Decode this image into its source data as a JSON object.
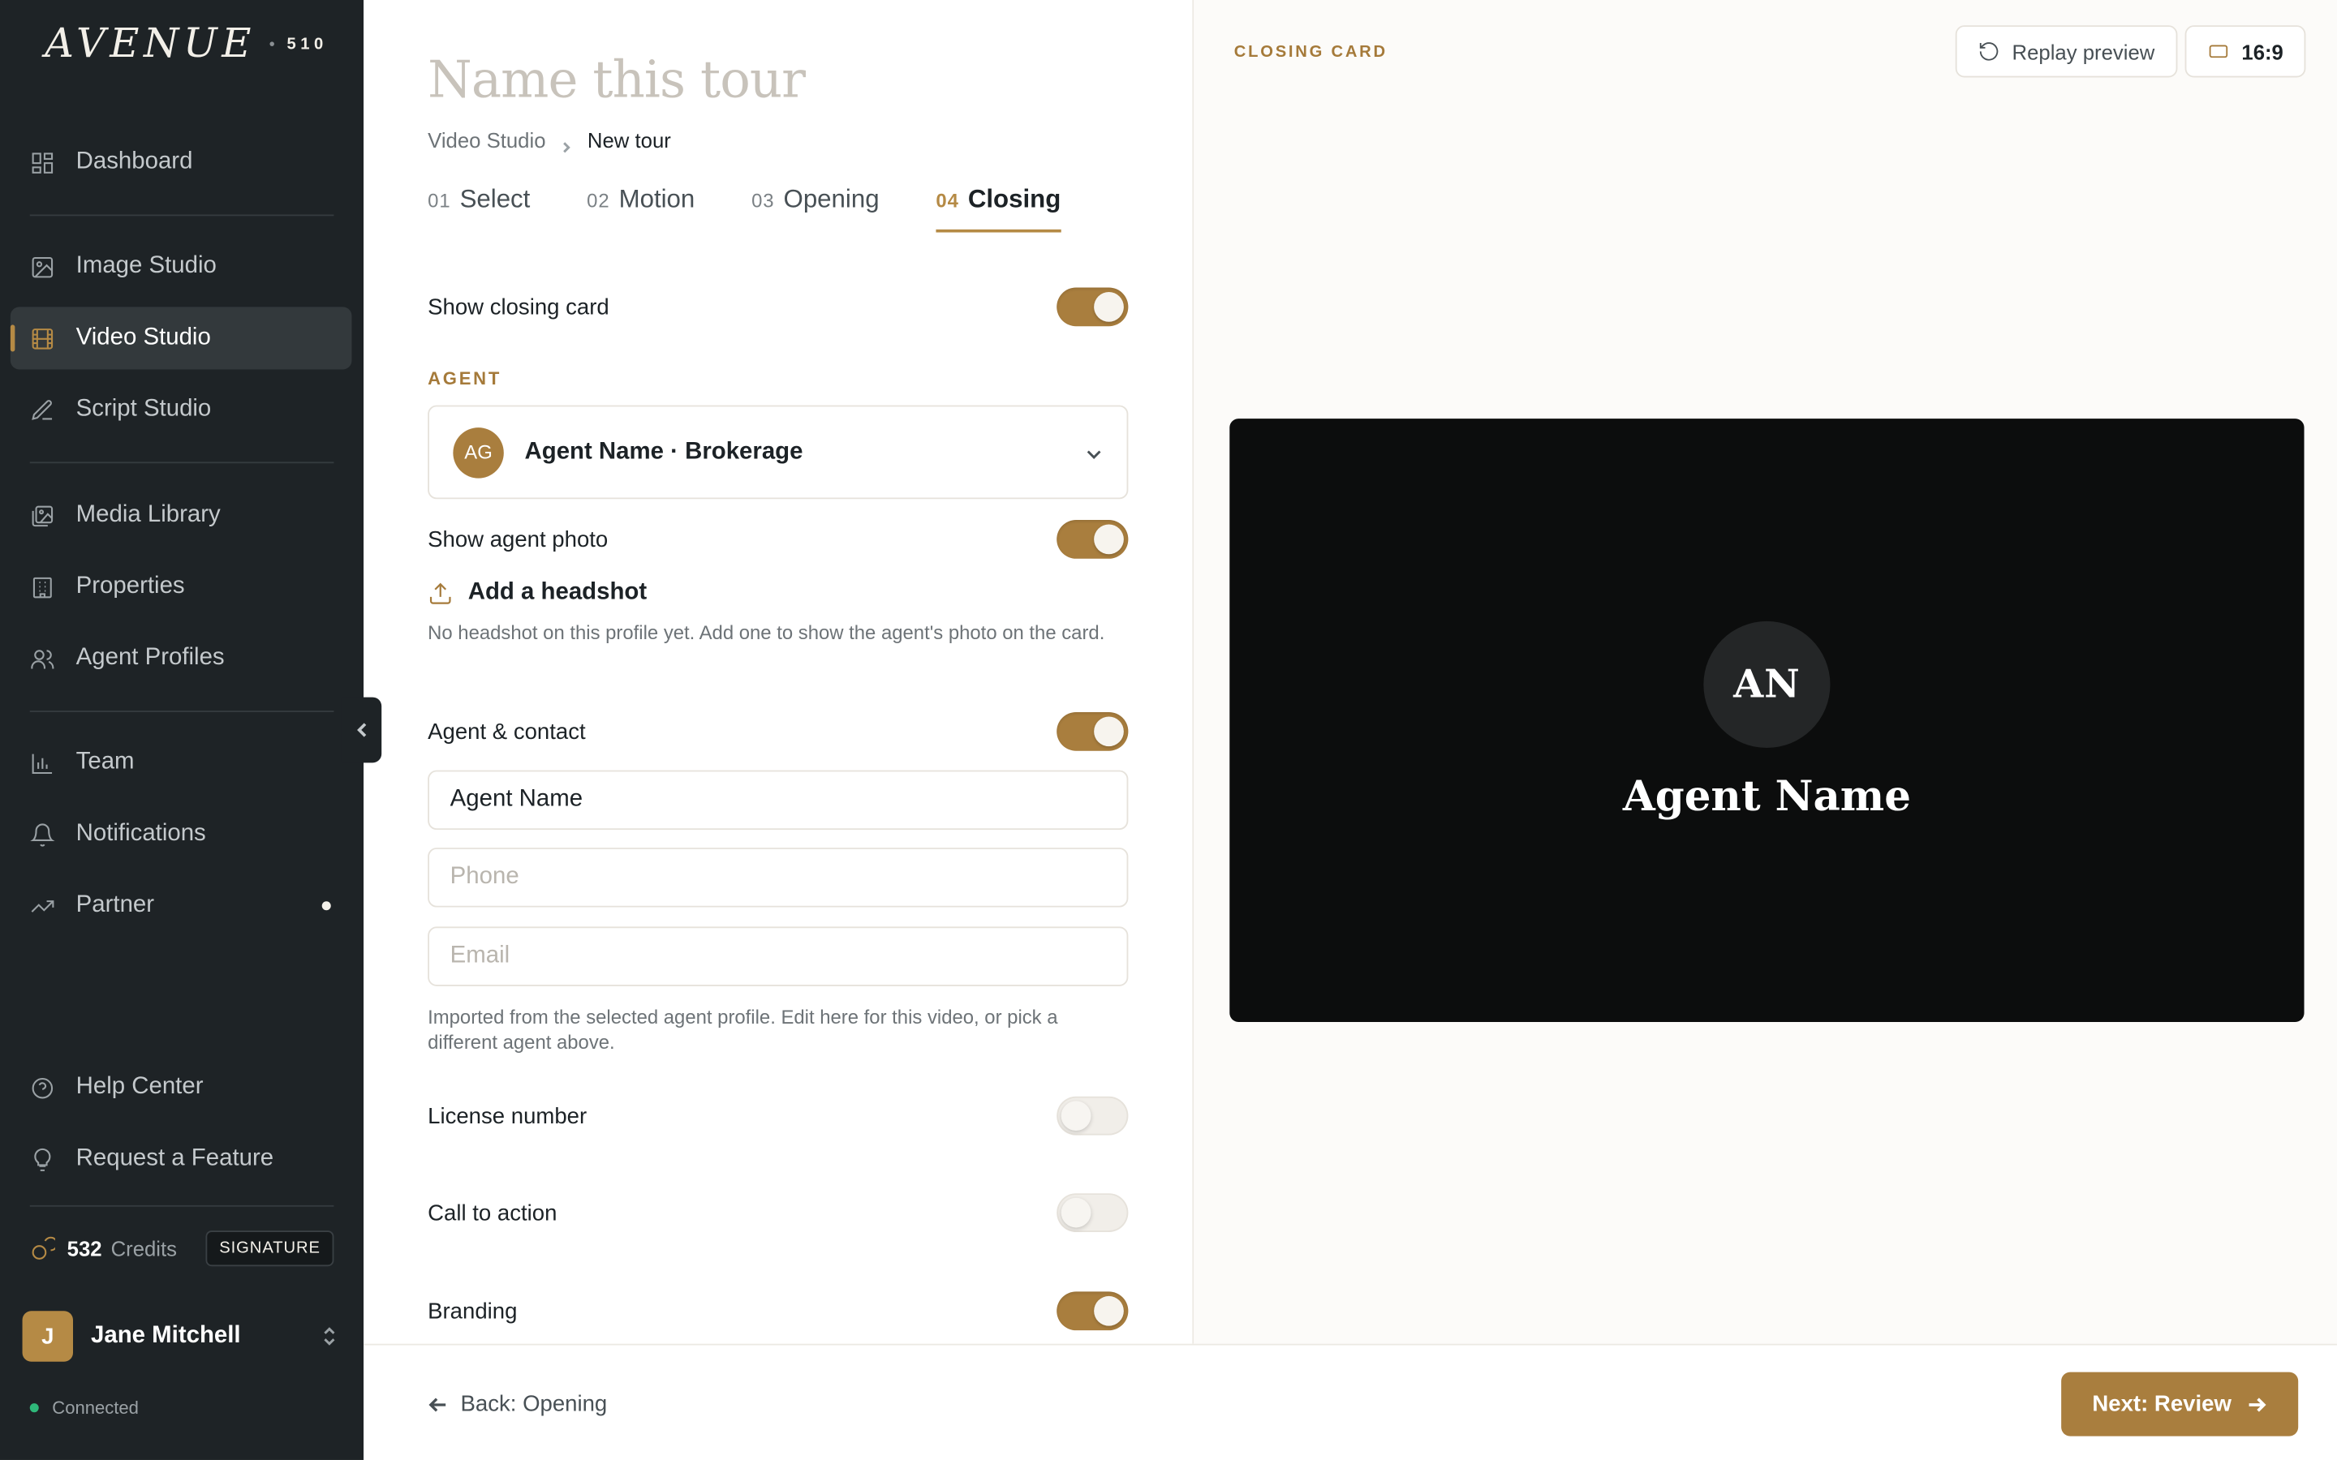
{
  "brand": {
    "word": "AVENUE",
    "suffix": "510"
  },
  "sidebar": {
    "items": [
      {
        "label": "Dashboard",
        "icon": "grid-icon"
      },
      {
        "label": "Image Studio",
        "icon": "image-icon"
      },
      {
        "label": "Video Studio",
        "icon": "film-icon",
        "active": true
      },
      {
        "label": "Script Studio",
        "icon": "pen-icon"
      },
      {
        "label": "Media Library",
        "icon": "images-icon"
      },
      {
        "label": "Properties",
        "icon": "building-icon"
      },
      {
        "label": "Agent Profiles",
        "icon": "users-icon"
      },
      {
        "label": "Team",
        "icon": "bar-chart-icon"
      },
      {
        "label": "Notifications",
        "icon": "bell-icon"
      },
      {
        "label": "Partner",
        "icon": "trending-up-icon"
      },
      {
        "label": "Help Center",
        "icon": "help-circle-icon"
      },
      {
        "label": "Request a Feature",
        "icon": "lightbulb-icon"
      }
    ],
    "credits": {
      "count": "532",
      "label": "Credits",
      "plan": "SIGNATURE"
    },
    "user": {
      "initial": "J",
      "name": "Jane Mitchell"
    },
    "status": "Connected"
  },
  "editor": {
    "title_placeholder": "Name this tour",
    "breadcrumb": {
      "parent": "Video Studio",
      "current": "New tour"
    },
    "tabs": [
      {
        "num": "01",
        "label": "Select"
      },
      {
        "num": "02",
        "label": "Motion"
      },
      {
        "num": "03",
        "label": "Opening"
      },
      {
        "num": "04",
        "label": "Closing",
        "active": true
      }
    ],
    "show_closing_card": "Show closing card",
    "agent_section": "AGENT",
    "agent_select": {
      "initials": "AG",
      "label": "Agent Name · Brokerage"
    },
    "show_agent_photo": "Show agent photo",
    "add_headshot": "Add a headshot",
    "headshot_help": "No headshot on this profile yet. Add one to show the agent's photo on the card.",
    "agent_contact": "Agent & contact",
    "fields": {
      "name_value": "Agent Name",
      "phone_placeholder": "Phone",
      "email_placeholder": "Email"
    },
    "contact_help": "Imported from the selected agent profile. Edit here for this video, or pick a different agent above.",
    "license_number": "License number",
    "call_to_action": "Call to action",
    "branding": "Branding",
    "toggles": {
      "show_closing_card": true,
      "show_agent_photo": true,
      "agent_contact": true,
      "license_number": false,
      "call_to_action": false,
      "branding": true
    }
  },
  "preview": {
    "label": "CLOSING CARD",
    "replay": "Replay preview",
    "ratio": "16:9",
    "card": {
      "initials": "AN",
      "name": "Agent Name"
    }
  },
  "footer": {
    "back": "Back: Opening",
    "next": "Next: Review"
  },
  "colors": {
    "accent": "#a97e3e",
    "sidebar_bg": "#1e2326",
    "status_green": "#2fb87a"
  }
}
